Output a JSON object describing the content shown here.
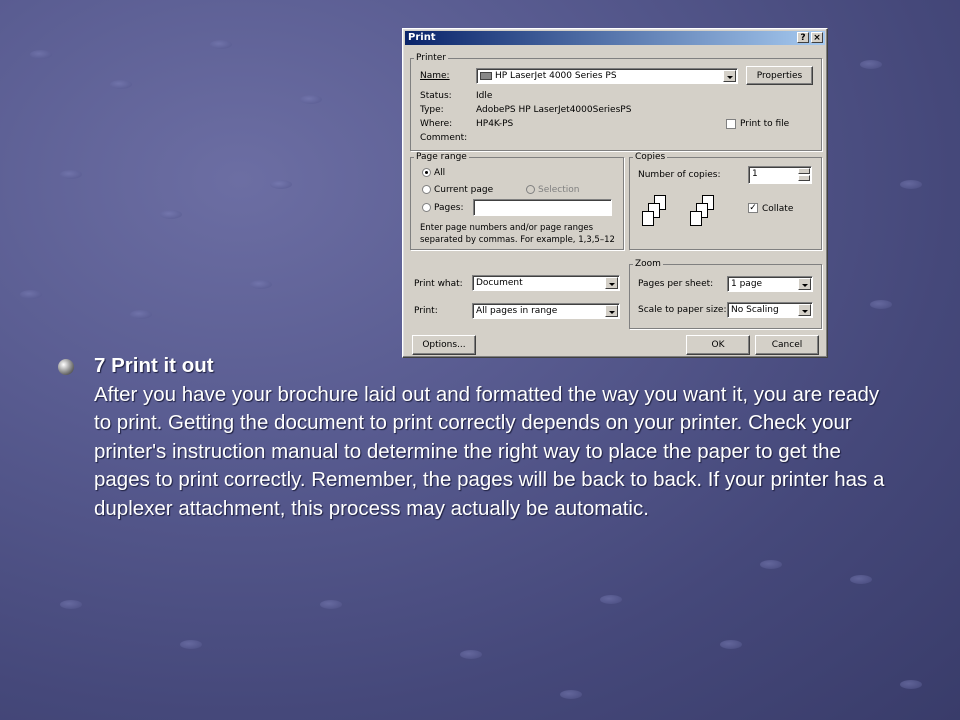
{
  "dialog": {
    "title": "Print",
    "help_label": "?",
    "close_label": "×",
    "printer": {
      "group_label": "Printer",
      "name_label": "Name:",
      "name_value": "HP LaserJet 4000 Series PS",
      "properties_label": "Properties",
      "status_label": "Status:",
      "status_value": "Idle",
      "type_label": "Type:",
      "type_value": "AdobePS HP LaserJet4000SeriesPS",
      "where_label": "Where:",
      "where_value": "HP4K-PS",
      "comment_label": "Comment:",
      "print_to_file_label": "Print to file"
    },
    "page_range": {
      "group_label": "Page range",
      "all_label": "All",
      "current_page_label": "Current page",
      "selection_label": "Selection",
      "pages_label": "Pages:",
      "pages_value": "",
      "hint_line1": "Enter page numbers and/or page ranges",
      "hint_line2": "separated by commas.  For example, 1,3,5–12"
    },
    "copies": {
      "group_label": "Copies",
      "number_label": "Number of copies:",
      "number_value": "1",
      "collate_label": "Collate",
      "collate_checked": true
    },
    "print_what_label": "Print what:",
    "print_what_value": "Document",
    "print_label": "Print:",
    "print_value": "All pages in range",
    "zoom": {
      "group_label": "Zoom",
      "pages_per_sheet_label": "Pages per sheet:",
      "pages_per_sheet_value": "1 page",
      "scale_label": "Scale to paper size:",
      "scale_value": "No Scaling"
    },
    "options_label": "Options...",
    "ok_label": "OK",
    "cancel_label": "Cancel"
  },
  "slide": {
    "heading": "7  Print it out",
    "body": "After you have your brochure laid out and formatted the way you want it, you are ready to print. Getting the document to print correctly depends on your printer. Check your printer's instruction manual to determine the right way to place the paper to get the pages to print correctly. Remember, the pages will be back to back. If your printer has a duplexer attachment, this process may actually be automatic."
  }
}
